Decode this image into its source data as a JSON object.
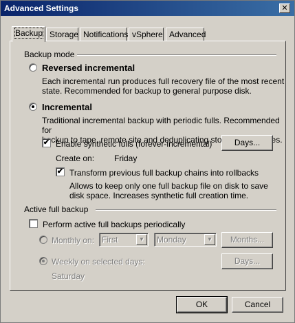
{
  "window": {
    "title": "Advanced Settings",
    "close_glyph": "✕"
  },
  "tabs": [
    {
      "label": "Backup",
      "active": true
    },
    {
      "label": "Storage",
      "active": false
    },
    {
      "label": "Notifications",
      "active": false
    },
    {
      "label": "vSphere",
      "active": false
    },
    {
      "label": "Advanced",
      "active": false
    }
  ],
  "backup_mode": {
    "group_label": "Backup mode",
    "reversed": {
      "label": "Reversed incremental",
      "selected": false,
      "description_line1": "Each incremental run produces full recovery file of the most recent",
      "description_line2": "state. Recommended for backup to general purpose disk."
    },
    "incremental": {
      "label": "Incremental",
      "selected": true,
      "description_line1": "Traditional incremental backup with periodic fulls. Recommended for",
      "description_line2": "backup to tape, remote site and deduplicating storage appliances."
    },
    "synthetic": {
      "label": "Enable synthetic fulls (forever-incremental)",
      "checked": true,
      "checkmark": "✔",
      "days_button": "Days...",
      "create_on_label": "Create on:",
      "create_on_value": "Friday"
    },
    "transform": {
      "label": "Transform previous full backup chains into rollbacks",
      "checked": true,
      "checkmark": "✔",
      "description_line1": "Allows to keep only one full backup file on disk to save",
      "description_line2": "disk space. Increases synthetic full creation time."
    }
  },
  "active_full": {
    "group_label": "Active full backup",
    "perform": {
      "label": "Perform active full backups periodically",
      "checked": false
    },
    "monthly": {
      "label": "Monthly on:",
      "week_select": "First",
      "day_select": "Monday",
      "months_button": "Months..."
    },
    "weekly": {
      "label": "Weekly on selected days:",
      "days_button": "Days...",
      "selected_days": "Saturday"
    }
  },
  "footer": {
    "ok_label": "OK",
    "cancel_label": "Cancel"
  }
}
